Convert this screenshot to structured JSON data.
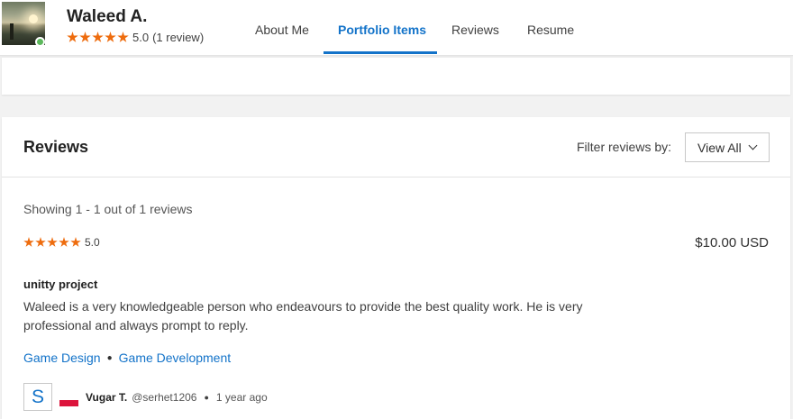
{
  "profile": {
    "name": "Waleed A.",
    "rating": "5.0",
    "review_count": "(1 review)",
    "status_color": "#5cb85c"
  },
  "tabs": [
    {
      "label": "About Me",
      "active": false
    },
    {
      "label": "Portfolio Items",
      "active": true
    },
    {
      "label": "Reviews",
      "active": false
    },
    {
      "label": "Resume",
      "active": false
    }
  ],
  "reviews": {
    "title": "Reviews",
    "filter_label": "Filter reviews by:",
    "filter_value": "View All",
    "showing_text": "Showing 1 - 1 out of 1 reviews",
    "items": [
      {
        "rating": "5.0",
        "price": "$10.00 USD",
        "project_title": "unitty project",
        "text": "Waleed is a very knowledgeable person who endeavours to provide the best quality work. He is very professional and always prompt to reply.",
        "skills": [
          "Game Design",
          "Game Development"
        ],
        "reviewer": {
          "avatar_letter": "S",
          "name": "Vugar T.",
          "handle": "@serhet1206",
          "time": "1 year ago"
        }
      }
    ]
  },
  "colors": {
    "accent": "#1373c9",
    "star": "#ee6c0e"
  }
}
